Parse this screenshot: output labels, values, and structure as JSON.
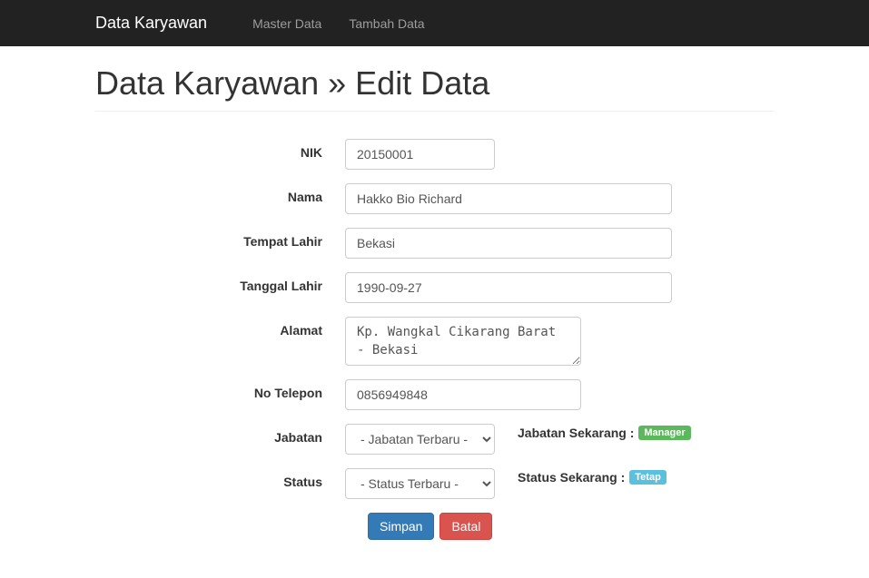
{
  "navbar": {
    "brand": "Data Karyawan",
    "items": [
      {
        "label": "Master Data"
      },
      {
        "label": "Tambah Data"
      }
    ]
  },
  "page": {
    "title": "Data Karyawan » Edit Data"
  },
  "form": {
    "nik": {
      "label": "NIK",
      "value": "20150001"
    },
    "nama": {
      "label": "Nama",
      "value": "Hakko Bio Richard"
    },
    "tempat_lahir": {
      "label": "Tempat Lahir",
      "value": "Bekasi"
    },
    "tanggal_lahir": {
      "label": "Tanggal Lahir",
      "value": "1990-09-27"
    },
    "alamat": {
      "label": "Alamat",
      "value": "Kp. Wangkal Cikarang Barat - Bekasi"
    },
    "no_telepon": {
      "label": "No Telepon",
      "value": "0856949848"
    },
    "jabatan": {
      "label": "Jabatan",
      "selected": "- Jabatan Terbaru -",
      "current_label": "Jabatan Sekarang :",
      "current_value": "Manager"
    },
    "status": {
      "label": "Status",
      "selected": "- Status Terbaru -",
      "current_label": "Status Sekarang :",
      "current_value": "Tetap"
    }
  },
  "buttons": {
    "save": "Simpan",
    "cancel": "Batal"
  }
}
